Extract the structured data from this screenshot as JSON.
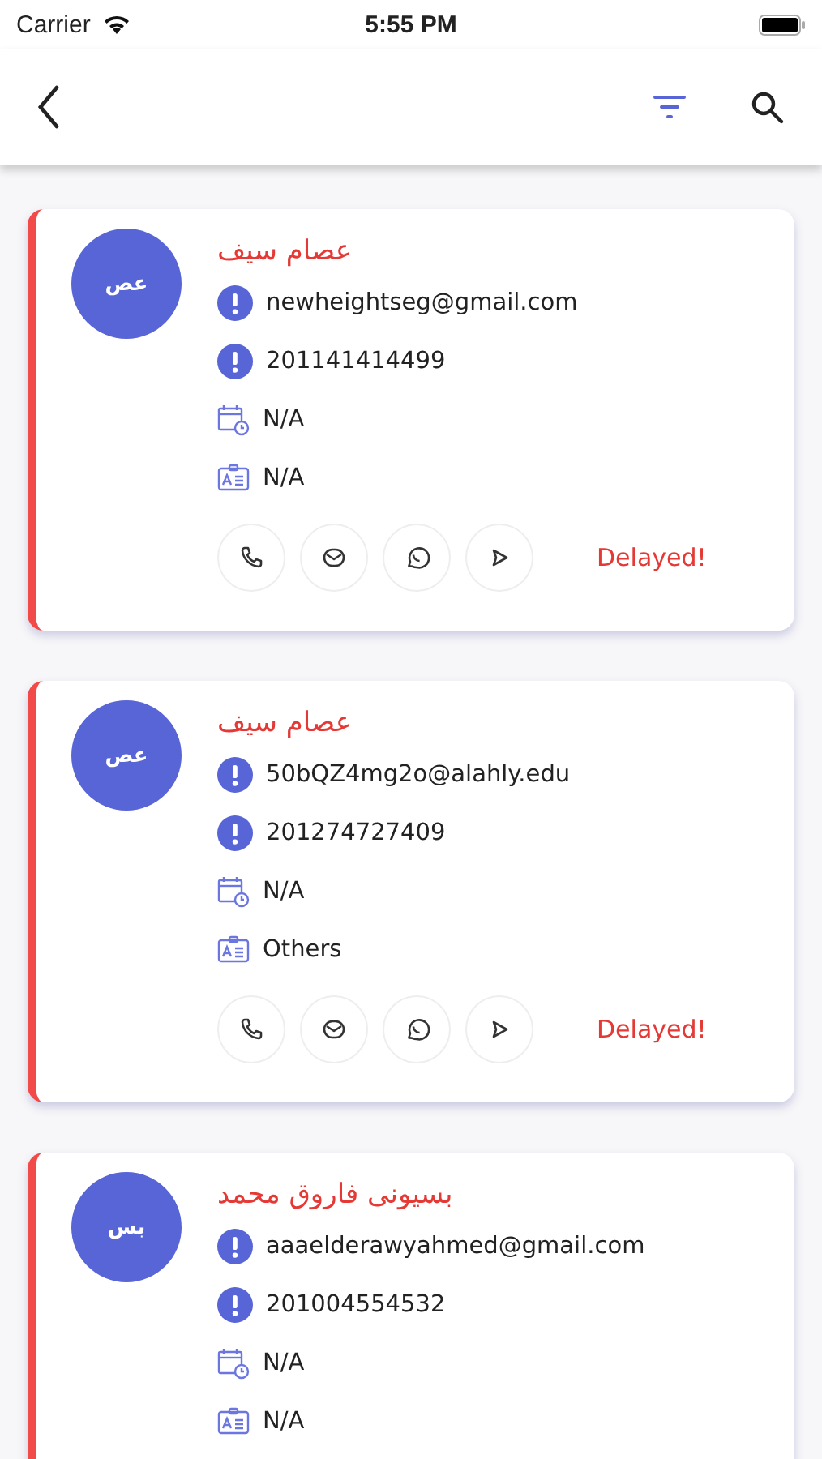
{
  "status_bar": {
    "carrier": "Carrier",
    "time": "5:55 PM"
  },
  "toolbar": {
    "filter_active": true
  },
  "cards": [
    {
      "avatar": "عص",
      "name": "عصام سيف",
      "rows": [
        {
          "kind": "alert",
          "text": "newheightseg@gmail.com"
        },
        {
          "kind": "alert",
          "text": "201141414499"
        },
        {
          "kind": "calendar",
          "text": "N/A"
        },
        {
          "kind": "idcard",
          "text": "N/A"
        }
      ],
      "actions": [
        {
          "kind": "phone"
        },
        {
          "kind": "mail"
        },
        {
          "kind": "whatsapp"
        },
        {
          "kind": "send"
        }
      ],
      "status": "Delayed!"
    },
    {
      "avatar": "عص",
      "name": "عصام سيف",
      "rows": [
        {
          "kind": "alert",
          "text": "50bQZ4mg2o@alahly.edu"
        },
        {
          "kind": "alert",
          "text": "201274727409"
        },
        {
          "kind": "calendar",
          "text": "N/A"
        },
        {
          "kind": "idcard",
          "text": "Others"
        }
      ],
      "actions": [
        {
          "kind": "phone"
        },
        {
          "kind": "mail"
        },
        {
          "kind": "whatsapp"
        },
        {
          "kind": "send"
        }
      ],
      "status": "Delayed!"
    },
    {
      "avatar": "بس",
      "name": "بسيونى فاروق محمد",
      "rows": [
        {
          "kind": "alert",
          "text": "aaaelderawyahmed@gmail.com"
        },
        {
          "kind": "alert",
          "text": "201004554532"
        },
        {
          "kind": "calendar",
          "text": "N/A"
        },
        {
          "kind": "idcard",
          "text": "N/A"
        }
      ]
    }
  ]
}
